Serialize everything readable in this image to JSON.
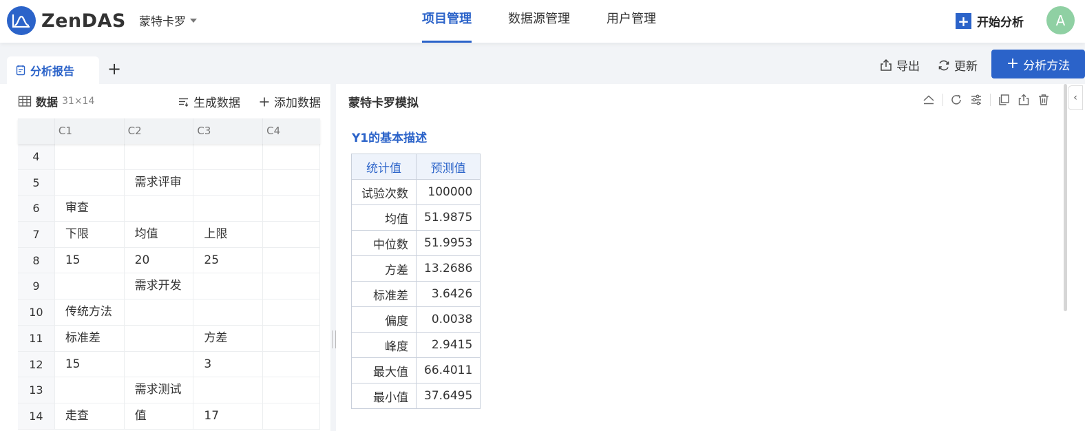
{
  "app": {
    "name": "ZenDAS",
    "project": "蒙特卡罗"
  },
  "nav": {
    "items": [
      "项目管理",
      "数据源管理",
      "用户管理"
    ],
    "active": "项目管理"
  },
  "header": {
    "start_analysis": "开始分析",
    "avatar": "A"
  },
  "tabbar": {
    "tab_label": "分析报告",
    "add_label": "+",
    "export_label": "导出",
    "refresh_label": "更新",
    "method_label": "分析方法"
  },
  "data_panel": {
    "title": "数据",
    "dims": "31×14",
    "generate_label": "生成数据",
    "add_label": "添加数据",
    "columns": [
      "C1",
      "C2",
      "C3",
      "C4"
    ],
    "rows": [
      {
        "idx": "4",
        "cells": [
          "",
          "",
          "",
          ""
        ]
      },
      {
        "idx": "5",
        "cells": [
          "",
          "需求评审",
          "",
          ""
        ]
      },
      {
        "idx": "6",
        "cells": [
          "审查",
          "",
          "",
          ""
        ]
      },
      {
        "idx": "7",
        "cells": [
          "下限",
          "均值",
          "上限",
          ""
        ]
      },
      {
        "idx": "8",
        "cells": [
          "15",
          "20",
          "25",
          ""
        ]
      },
      {
        "idx": "9",
        "cells": [
          "",
          "需求开发",
          "",
          ""
        ]
      },
      {
        "idx": "10",
        "cells": [
          "传统方法",
          "",
          "",
          ""
        ]
      },
      {
        "idx": "11",
        "cells": [
          "标准差",
          "",
          "方差",
          ""
        ]
      },
      {
        "idx": "12",
        "cells": [
          "15",
          "",
          "3",
          ""
        ]
      },
      {
        "idx": "13",
        "cells": [
          "",
          "需求测试",
          "",
          ""
        ]
      },
      {
        "idx": "14",
        "cells": [
          "走查",
          "值",
          "17",
          ""
        ]
      }
    ]
  },
  "result_panel": {
    "title": "蒙特卡罗模拟",
    "section_title": "Y1的基本描述",
    "collapse_label": "‹",
    "table_headers": [
      "统计值",
      "预测值"
    ],
    "table_rows": [
      [
        "试验次数",
        "100000"
      ],
      [
        "均值",
        "51.9875"
      ],
      [
        "中位数",
        "51.9953"
      ],
      [
        "方差",
        "13.2686"
      ],
      [
        "标准差",
        "3.6426"
      ],
      [
        "偏度",
        "0.0038"
      ],
      [
        "峰度",
        "2.9415"
      ],
      [
        "最大值",
        "66.4011"
      ],
      [
        "最小值",
        "37.6495"
      ]
    ]
  },
  "colors": {
    "accent": "#2b63c9",
    "avatar": "#8fd0a3"
  }
}
